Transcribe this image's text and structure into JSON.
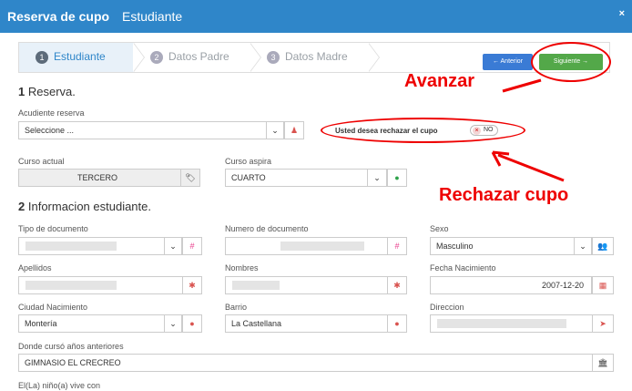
{
  "modal": {
    "title_bold": "Reserva de cupo",
    "title_sub": "Estudiante",
    "close": "×"
  },
  "wizard": {
    "steps": [
      {
        "num": "1",
        "label": "Estudiante"
      },
      {
        "num": "2",
        "label": "Datos Padre"
      },
      {
        "num": "3",
        "label": "Datos Madre"
      }
    ],
    "prev_label": "← Anterior",
    "next_label": "Siguiente →"
  },
  "annotations": {
    "avanzar": "Avanzar",
    "rechazar": "Rechazar cupo"
  },
  "section1": {
    "num": "1",
    "title": "Reserva."
  },
  "reserva": {
    "acudiente_label": "Acudiente reserva",
    "acudiente_value": "Seleccione ...",
    "rechazar_label": "Usted desea rechazar el cupo",
    "toggle_value": "NO"
  },
  "curso": {
    "actual_label": "Curso actual",
    "actual_value": "TERCERO",
    "aspira_label": "Curso aspira",
    "aspira_value": "CUARTO"
  },
  "section2": {
    "num": "2",
    "title": "Informacion estudiante."
  },
  "student": {
    "tipo_label": "Tipo de documento",
    "numero_label": "Numero de documento",
    "sexo_label": "Sexo",
    "sexo_value": "Masculino",
    "apellidos_label": "Apellidos",
    "nombres_label": "Nombres",
    "fecha_label": "Fecha Nacimiento",
    "fecha_value": "2007-12-20",
    "ciudad_label": "Ciudad Nacimiento",
    "ciudad_value": "Montería",
    "barrio_label": "Barrio",
    "barrio_value": "La Castellana",
    "direccion_label": "Direccion",
    "donde_label": "Donde cursó años anteriores",
    "donde_value": "GIMNASIO EL CRECREO",
    "vive_label": "El(La) niño(a) vive con"
  },
  "colors": {
    "header": "#2f86c9",
    "annotation": "#ee0000",
    "next_button": "#53a849",
    "prev_button": "#3a7bd5"
  }
}
